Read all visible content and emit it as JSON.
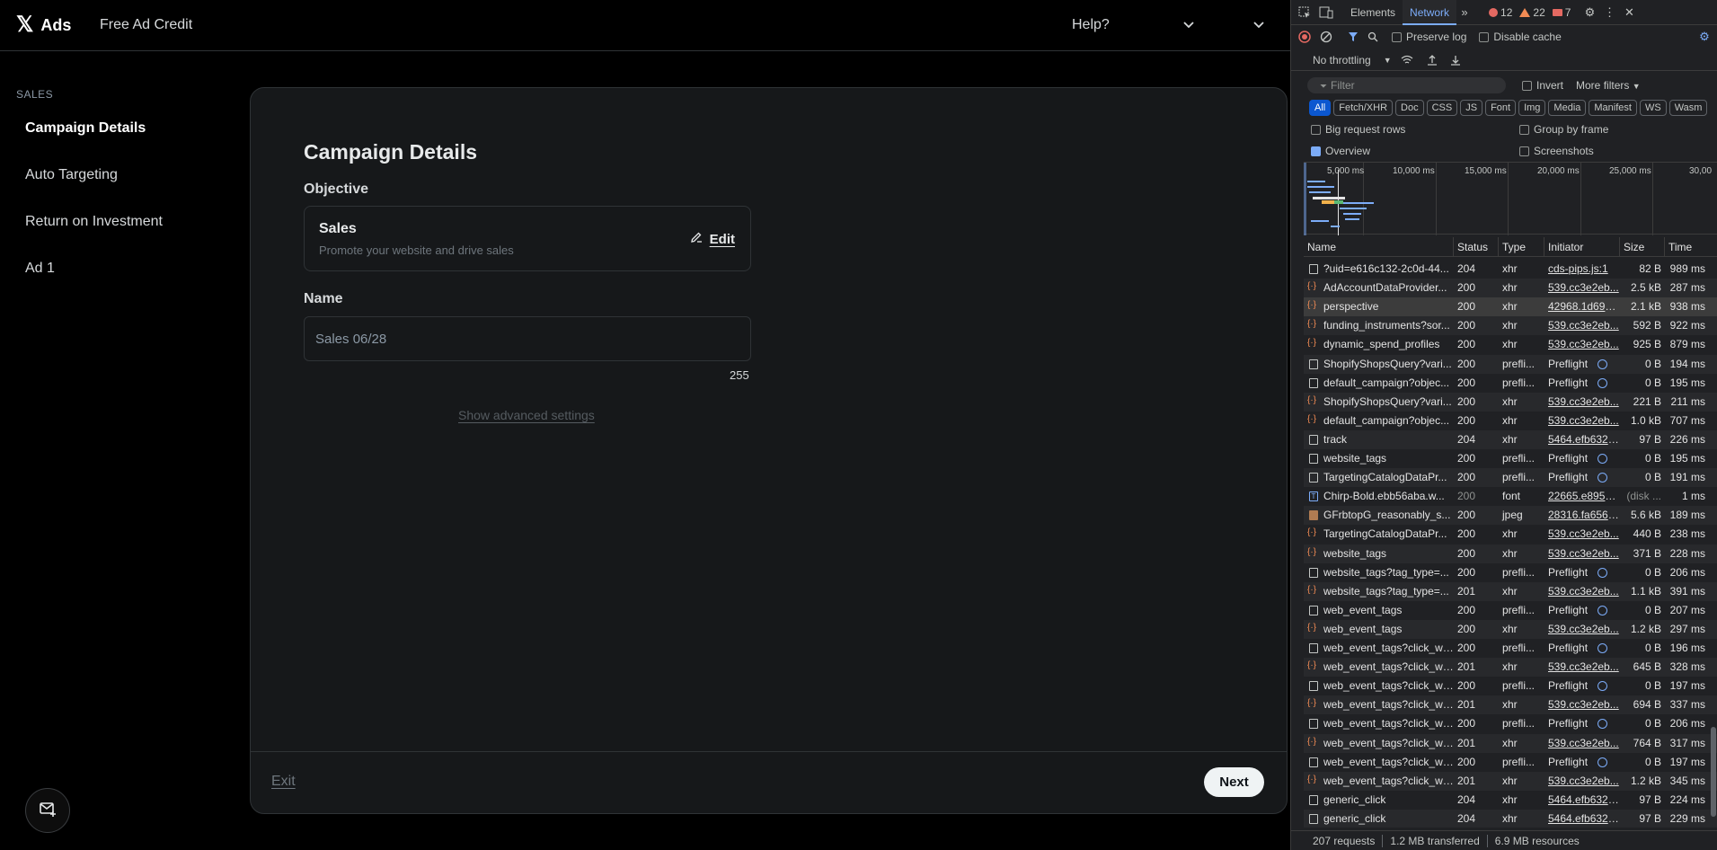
{
  "app": {
    "logo_text": "Ads",
    "logo_glyph": "𝕏",
    "credit_link": "Free Ad Credit",
    "help": "Help?"
  },
  "sidebar": {
    "section": "SALES",
    "items": [
      {
        "label": "Campaign Details",
        "active": true
      },
      {
        "label": "Auto Targeting",
        "active": false
      },
      {
        "label": "Return on Investment",
        "active": false
      },
      {
        "label": "Ad 1",
        "active": false
      }
    ]
  },
  "panel": {
    "title": "Campaign Details",
    "objective_label": "Objective",
    "objective_title": "Sales",
    "objective_desc": "Promote your website and drive sales",
    "edit": "Edit",
    "name_label": "Name",
    "name_value": "Sales 06/28",
    "char_count": "255",
    "advanced": "Show advanced settings",
    "exit": "Exit",
    "next": "Next"
  },
  "devtools": {
    "tabs": [
      "Elements",
      "Network"
    ],
    "active_tab": "Network",
    "errors": "12",
    "warnings": "22",
    "issues": "7",
    "preserve_log": "Preserve log",
    "disable_cache": "Disable cache",
    "throttling": "No throttling",
    "filter_placeholder": "Filter",
    "invert": "Invert",
    "more_filters": "More filters",
    "type_filters": [
      "All",
      "Fetch/XHR",
      "Doc",
      "CSS",
      "JS",
      "Font",
      "Img",
      "Media",
      "Manifest",
      "WS",
      "Wasm"
    ],
    "big_request_rows": "Big request rows",
    "group_by_frame": "Group by frame",
    "overview_label": "Overview",
    "screenshots": "Screenshots",
    "timeline_ticks": [
      "5,000 ms",
      "10,000 ms",
      "15,000 ms",
      "20,000 ms",
      "25,000 ms",
      "30,00"
    ],
    "columns": [
      "Name",
      "Status",
      "Type",
      "Initiator",
      "Size",
      "Time"
    ],
    "rows": [
      {
        "name": "?uid=e616c132-2c0d-44...",
        "status": "204",
        "type": "xhr",
        "initiator": "cds-pips.js:1",
        "size": "82 B",
        "time": "989 ms",
        "icon": "doc"
      },
      {
        "name": "AdAccountDataProvider...",
        "status": "200",
        "type": "xhr",
        "initiator": "539.cc3e2eb...",
        "size": "2.5 kB",
        "time": "287 ms",
        "icon": "xhr"
      },
      {
        "name": "perspective",
        "status": "200",
        "type": "xhr",
        "initiator": "42968.1d6935t",
        "size": "2.1 kB",
        "time": "938 ms",
        "icon": "xhr"
      },
      {
        "name": "funding_instruments?sor...",
        "status": "200",
        "type": "xhr",
        "initiator": "539.cc3e2eb...",
        "size": "592 B",
        "time": "922 ms",
        "icon": "xhr"
      },
      {
        "name": "dynamic_spend_profiles",
        "status": "200",
        "type": "xhr",
        "initiator": "539.cc3e2eb...",
        "size": "925 B",
        "time": "879 ms",
        "icon": "xhr"
      },
      {
        "name": "ShopifyShopsQuery?vari...",
        "status": "200",
        "type": "prefli...",
        "initiator": "Preflight",
        "size": "0 B",
        "time": "194 ms",
        "icon": "doc"
      },
      {
        "name": "default_campaign?objec...",
        "status": "200",
        "type": "prefli...",
        "initiator": "Preflight",
        "size": "0 B",
        "time": "195 ms",
        "icon": "doc"
      },
      {
        "name": "ShopifyShopsQuery?vari...",
        "status": "200",
        "type": "xhr",
        "initiator": "539.cc3e2eb...",
        "size": "221 B",
        "time": "211 ms",
        "icon": "xhr"
      },
      {
        "name": "default_campaign?objec...",
        "status": "200",
        "type": "xhr",
        "initiator": "539.cc3e2eb...",
        "size": "1.0 kB",
        "time": "707 ms",
        "icon": "xhr"
      },
      {
        "name": "track",
        "status": "204",
        "type": "xhr",
        "initiator": "5464.efb6324...",
        "size": "97 B",
        "time": "226 ms",
        "icon": "doc"
      },
      {
        "name": "website_tags",
        "status": "200",
        "type": "prefli...",
        "initiator": "Preflight",
        "size": "0 B",
        "time": "195 ms",
        "icon": "doc"
      },
      {
        "name": "TargetingCatalogDataPr...",
        "status": "200",
        "type": "prefli...",
        "initiator": "Preflight",
        "size": "0 B",
        "time": "191 ms",
        "icon": "doc"
      },
      {
        "name": "Chirp-Bold.ebb56aba.w...",
        "status": "200",
        "type": "font",
        "initiator": "22665.e8959d6",
        "size": "(disk ...",
        "time": "1 ms",
        "icon": "font"
      },
      {
        "name": "GFrbtopG_reasonably_s...",
        "status": "200",
        "type": "jpeg",
        "initiator": "28316.fa656fb...",
        "size": "5.6 kB",
        "time": "189 ms",
        "icon": "img"
      },
      {
        "name": "TargetingCatalogDataPr...",
        "status": "200",
        "type": "xhr",
        "initiator": "539.cc3e2eb...",
        "size": "440 B",
        "time": "238 ms",
        "icon": "xhr"
      },
      {
        "name": "website_tags",
        "status": "200",
        "type": "xhr",
        "initiator": "539.cc3e2eb...",
        "size": "371 B",
        "time": "228 ms",
        "icon": "xhr"
      },
      {
        "name": "website_tags?tag_type=...",
        "status": "200",
        "type": "prefli...",
        "initiator": "Preflight",
        "size": "0 B",
        "time": "206 ms",
        "icon": "doc"
      },
      {
        "name": "website_tags?tag_type=...",
        "status": "201",
        "type": "xhr",
        "initiator": "539.cc3e2eb...",
        "size": "1.1 kB",
        "time": "391 ms",
        "icon": "xhr"
      },
      {
        "name": "web_event_tags",
        "status": "200",
        "type": "prefli...",
        "initiator": "Preflight",
        "size": "0 B",
        "time": "207 ms",
        "icon": "doc"
      },
      {
        "name": "web_event_tags",
        "status": "200",
        "type": "xhr",
        "initiator": "539.cc3e2eb...",
        "size": "1.2 kB",
        "time": "297 ms",
        "icon": "xhr"
      },
      {
        "name": "web_event_tags?click_wi...",
        "status": "200",
        "type": "prefli...",
        "initiator": "Preflight",
        "size": "0 B",
        "time": "196 ms",
        "icon": "doc"
      },
      {
        "name": "web_event_tags?click_wi...",
        "status": "201",
        "type": "xhr",
        "initiator": "539.cc3e2eb...",
        "size": "645 B",
        "time": "328 ms",
        "icon": "xhr"
      },
      {
        "name": "web_event_tags?click_wi...",
        "status": "200",
        "type": "prefli...",
        "initiator": "Preflight",
        "size": "0 B",
        "time": "197 ms",
        "icon": "doc"
      },
      {
        "name": "web_event_tags?click_wi...",
        "status": "201",
        "type": "xhr",
        "initiator": "539.cc3e2eb...",
        "size": "694 B",
        "time": "337 ms",
        "icon": "xhr"
      },
      {
        "name": "web_event_tags?click_wi...",
        "status": "200",
        "type": "prefli...",
        "initiator": "Preflight",
        "size": "0 B",
        "time": "206 ms",
        "icon": "doc"
      },
      {
        "name": "web_event_tags?click_wi...",
        "status": "201",
        "type": "xhr",
        "initiator": "539.cc3e2eb...",
        "size": "764 B",
        "time": "317 ms",
        "icon": "xhr"
      },
      {
        "name": "web_event_tags?click_wi...",
        "status": "200",
        "type": "prefli...",
        "initiator": "Preflight",
        "size": "0 B",
        "time": "197 ms",
        "icon": "doc"
      },
      {
        "name": "web_event_tags?click_wi...",
        "status": "201",
        "type": "xhr",
        "initiator": "539.cc3e2eb...",
        "size": "1.2 kB",
        "time": "345 ms",
        "icon": "xhr"
      },
      {
        "name": "generic_click",
        "status": "204",
        "type": "xhr",
        "initiator": "5464.efb6324...",
        "size": "97 B",
        "time": "224 ms",
        "icon": "doc"
      },
      {
        "name": "generic_click",
        "status": "204",
        "type": "xhr",
        "initiator": "5464.efb6324...",
        "size": "97 B",
        "time": "229 ms",
        "icon": "doc"
      }
    ],
    "status": {
      "requests": "207 requests",
      "transferred": "1.2 MB transferred",
      "resources": "6.9 MB resources"
    }
  }
}
